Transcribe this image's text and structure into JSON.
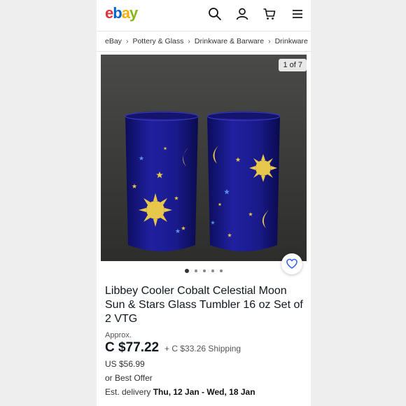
{
  "header": {
    "logo": {
      "e": "e",
      "b": "b",
      "a": "a",
      "y": "y"
    },
    "icons": [
      "search-icon",
      "account-icon",
      "cart-icon",
      "menu-icon"
    ]
  },
  "breadcrumb": [
    "eBay",
    "Pottery & Glass",
    "Drinkware & Barware",
    "Drinkware"
  ],
  "gallery": {
    "counter": "1 of 7",
    "dot_count": 5,
    "active_dot": 0
  },
  "listing": {
    "title": "Libbey Cooler Cobalt Celestial Moon Sun & Stars Glass Tumbler 16 oz Set of 2 VTG",
    "approx_label": "Approx.",
    "price": "C $77.22",
    "shipping": "+ C $33.26 Shipping",
    "usd_price": "US $56.99",
    "best_offer": "or Best Offer",
    "delivery_label": "Est. delivery",
    "delivery_dates": "Thu, 12 Jan - Wed, 18 Jan"
  },
  "colors": {
    "accent_blue": "#3665f3",
    "logo_red": "#e53238",
    "logo_blue": "#0064d2",
    "logo_yellow": "#f5af02",
    "logo_green": "#86b817",
    "glass_cobalt": "#1a1a8c",
    "motif_gold": "#e8c84a"
  }
}
